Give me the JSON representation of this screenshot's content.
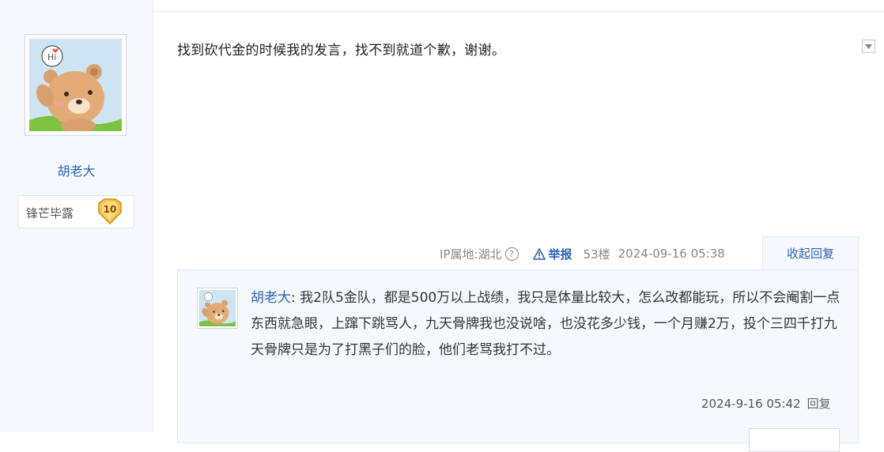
{
  "user": {
    "name": "胡老大",
    "badge_title": "锋芒毕露",
    "badge_level": "10"
  },
  "post": {
    "text": "找到砍代金的时候我的发言，找不到就道个歉，谢谢。",
    "ip_location": "IP属地:湖北",
    "help_symbol": "?",
    "report_label": "举报",
    "floor": "53楼",
    "time": "2024-09-16 05:38",
    "collapse_replies_label": "收起回复"
  },
  "replies": [
    {
      "author": "胡老大",
      "text": "我2队5金队，都是500万以上战绩，我只是体量比较大，怎么改都能玩，所以不会阉割一点东西就急眼，上蹿下跳骂人，九天骨牌我也没说啥，也没花多少钱，一个月赚2万，投个三四千打九天骨牌只是为了打黑子们的脸，他们老骂我打不过。",
      "time": "2024-9-16 05:42",
      "reply_label": "回复"
    }
  ],
  "colors": {
    "link_blue": "#2d64b3",
    "sidebar_bg": "#f5f8fd",
    "badge_gold": "#f3c44c"
  },
  "icons": {
    "collapse": "chevron-down-icon",
    "report": "warning-icon",
    "help": "help-circle-icon"
  }
}
